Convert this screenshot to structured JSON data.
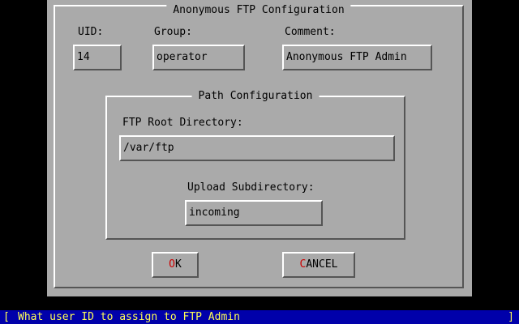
{
  "dialog": {
    "title": "Anonymous FTP Configuration",
    "uid": {
      "label": "UID:",
      "value": "14"
    },
    "group": {
      "label": "Group:",
      "value": "operator"
    },
    "comment": {
      "label": "Comment:",
      "value": "Anonymous FTP Admin"
    },
    "path_section": {
      "title": "Path Configuration",
      "root_dir": {
        "label": "FTP Root Directory:",
        "value": "/var/ftp"
      },
      "upload_dir": {
        "label": "Upload Subdirectory:",
        "value": "incoming"
      }
    },
    "buttons": {
      "ok": {
        "hotkey": "O",
        "rest": "K"
      },
      "cancel": {
        "hotkey": "C",
        "rest": "ANCEL"
      }
    }
  },
  "status_bar": {
    "left_bracket": "[",
    "message": "What user ID to assign to FTP Admin",
    "right_bracket": "]"
  },
  "colors": {
    "background": "#000000",
    "dialog": "#aaaaaa",
    "status_bar_bg": "#0000aa",
    "status_bar_text": "#ffff55",
    "hotkey": "#cc0000"
  }
}
